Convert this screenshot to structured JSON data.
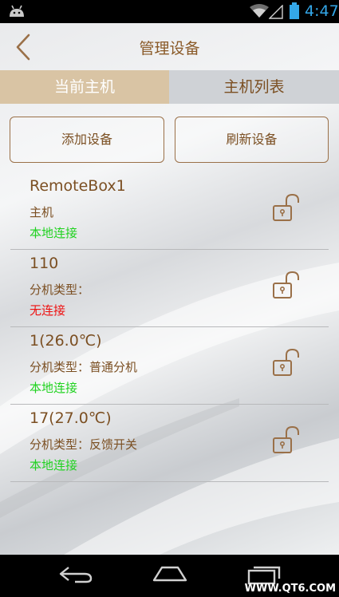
{
  "status_bar": {
    "time": "4:47",
    "icons": [
      "android-icon",
      "wifi-icon",
      "signal-icon",
      "battery-icon"
    ],
    "time_color": "#34a7e8"
  },
  "header": {
    "title": "管理设备",
    "back_icon": "chevron-left-icon"
  },
  "tabs": [
    {
      "label": "当前主机",
      "active": true
    },
    {
      "label": "主机列表",
      "active": false
    }
  ],
  "actions": {
    "add_label": "添加设备",
    "refresh_label": "刷新设备"
  },
  "devices": [
    {
      "name": "RemoteBox1",
      "type": "主机",
      "connection": "本地连接",
      "connection_color": "#1fd21f",
      "lock_icon": "unlocked-padlock-icon"
    },
    {
      "name": "110",
      "type": "分机类型：",
      "connection": "无连接",
      "connection_color": "#ee1111",
      "lock_icon": "unlocked-padlock-icon"
    },
    {
      "name": "1(26.0℃)",
      "type": "分机类型：普通分机",
      "connection": "本地连接",
      "connection_color": "#1fd21f",
      "lock_icon": "unlocked-padlock-icon"
    },
    {
      "name": "17(27.0℃)",
      "type": "分机类型：反馈开关",
      "connection": "本地连接",
      "connection_color": "#1fd21f",
      "lock_icon": "unlocked-padlock-icon"
    }
  ],
  "nav_bar": {
    "buttons": [
      "back-nav-icon",
      "home-nav-icon",
      "recents-nav-icon"
    ]
  },
  "watermark": "WWW.QT6.COM",
  "colors": {
    "accent_text": "#7b4f22",
    "active_tab_bg": "#d9c4a4",
    "inactive_tab_bg": "#cfd2d6"
  }
}
